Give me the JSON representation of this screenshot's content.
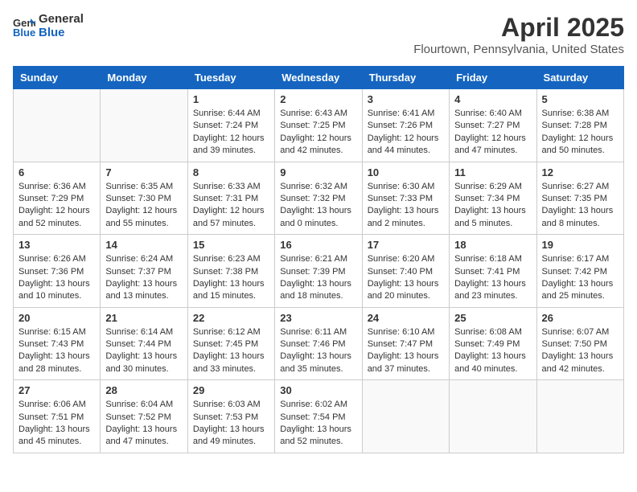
{
  "header": {
    "logo_general": "General",
    "logo_blue": "Blue",
    "month_title": "April 2025",
    "location": "Flourtown, Pennsylvania, United States"
  },
  "days_of_week": [
    "Sunday",
    "Monday",
    "Tuesday",
    "Wednesday",
    "Thursday",
    "Friday",
    "Saturday"
  ],
  "weeks": [
    [
      {
        "day": "",
        "info": ""
      },
      {
        "day": "",
        "info": ""
      },
      {
        "day": "1",
        "info": "Sunrise: 6:44 AM\nSunset: 7:24 PM\nDaylight: 12 hours and 39 minutes."
      },
      {
        "day": "2",
        "info": "Sunrise: 6:43 AM\nSunset: 7:25 PM\nDaylight: 12 hours and 42 minutes."
      },
      {
        "day": "3",
        "info": "Sunrise: 6:41 AM\nSunset: 7:26 PM\nDaylight: 12 hours and 44 minutes."
      },
      {
        "day": "4",
        "info": "Sunrise: 6:40 AM\nSunset: 7:27 PM\nDaylight: 12 hours and 47 minutes."
      },
      {
        "day": "5",
        "info": "Sunrise: 6:38 AM\nSunset: 7:28 PM\nDaylight: 12 hours and 50 minutes."
      }
    ],
    [
      {
        "day": "6",
        "info": "Sunrise: 6:36 AM\nSunset: 7:29 PM\nDaylight: 12 hours and 52 minutes."
      },
      {
        "day": "7",
        "info": "Sunrise: 6:35 AM\nSunset: 7:30 PM\nDaylight: 12 hours and 55 minutes."
      },
      {
        "day": "8",
        "info": "Sunrise: 6:33 AM\nSunset: 7:31 PM\nDaylight: 12 hours and 57 minutes."
      },
      {
        "day": "9",
        "info": "Sunrise: 6:32 AM\nSunset: 7:32 PM\nDaylight: 13 hours and 0 minutes."
      },
      {
        "day": "10",
        "info": "Sunrise: 6:30 AM\nSunset: 7:33 PM\nDaylight: 13 hours and 2 minutes."
      },
      {
        "day": "11",
        "info": "Sunrise: 6:29 AM\nSunset: 7:34 PM\nDaylight: 13 hours and 5 minutes."
      },
      {
        "day": "12",
        "info": "Sunrise: 6:27 AM\nSunset: 7:35 PM\nDaylight: 13 hours and 8 minutes."
      }
    ],
    [
      {
        "day": "13",
        "info": "Sunrise: 6:26 AM\nSunset: 7:36 PM\nDaylight: 13 hours and 10 minutes."
      },
      {
        "day": "14",
        "info": "Sunrise: 6:24 AM\nSunset: 7:37 PM\nDaylight: 13 hours and 13 minutes."
      },
      {
        "day": "15",
        "info": "Sunrise: 6:23 AM\nSunset: 7:38 PM\nDaylight: 13 hours and 15 minutes."
      },
      {
        "day": "16",
        "info": "Sunrise: 6:21 AM\nSunset: 7:39 PM\nDaylight: 13 hours and 18 minutes."
      },
      {
        "day": "17",
        "info": "Sunrise: 6:20 AM\nSunset: 7:40 PM\nDaylight: 13 hours and 20 minutes."
      },
      {
        "day": "18",
        "info": "Sunrise: 6:18 AM\nSunset: 7:41 PM\nDaylight: 13 hours and 23 minutes."
      },
      {
        "day": "19",
        "info": "Sunrise: 6:17 AM\nSunset: 7:42 PM\nDaylight: 13 hours and 25 minutes."
      }
    ],
    [
      {
        "day": "20",
        "info": "Sunrise: 6:15 AM\nSunset: 7:43 PM\nDaylight: 13 hours and 28 minutes."
      },
      {
        "day": "21",
        "info": "Sunrise: 6:14 AM\nSunset: 7:44 PM\nDaylight: 13 hours and 30 minutes."
      },
      {
        "day": "22",
        "info": "Sunrise: 6:12 AM\nSunset: 7:45 PM\nDaylight: 13 hours and 33 minutes."
      },
      {
        "day": "23",
        "info": "Sunrise: 6:11 AM\nSunset: 7:46 PM\nDaylight: 13 hours and 35 minutes."
      },
      {
        "day": "24",
        "info": "Sunrise: 6:10 AM\nSunset: 7:47 PM\nDaylight: 13 hours and 37 minutes."
      },
      {
        "day": "25",
        "info": "Sunrise: 6:08 AM\nSunset: 7:49 PM\nDaylight: 13 hours and 40 minutes."
      },
      {
        "day": "26",
        "info": "Sunrise: 6:07 AM\nSunset: 7:50 PM\nDaylight: 13 hours and 42 minutes."
      }
    ],
    [
      {
        "day": "27",
        "info": "Sunrise: 6:06 AM\nSunset: 7:51 PM\nDaylight: 13 hours and 45 minutes."
      },
      {
        "day": "28",
        "info": "Sunrise: 6:04 AM\nSunset: 7:52 PM\nDaylight: 13 hours and 47 minutes."
      },
      {
        "day": "29",
        "info": "Sunrise: 6:03 AM\nSunset: 7:53 PM\nDaylight: 13 hours and 49 minutes."
      },
      {
        "day": "30",
        "info": "Sunrise: 6:02 AM\nSunset: 7:54 PM\nDaylight: 13 hours and 52 minutes."
      },
      {
        "day": "",
        "info": ""
      },
      {
        "day": "",
        "info": ""
      },
      {
        "day": "",
        "info": ""
      }
    ]
  ]
}
